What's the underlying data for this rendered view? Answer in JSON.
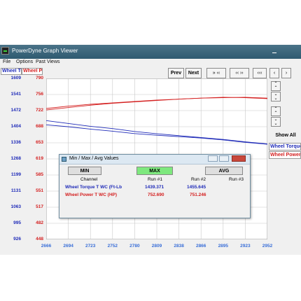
{
  "window": {
    "title": "PowerDyne Graph Viewer"
  },
  "menu": {
    "items": [
      "File",
      "Options",
      "Past Views"
    ]
  },
  "legend_header": {
    "torque_label": "Wheel Tc",
    "power_label": "Wheel Pc"
  },
  "toolbar": {
    "prev": "Prev",
    "next": "Next",
    "zoom_out_far": "» ‹‹",
    "zoom_in": "‹‹ ››",
    "scroll_left_far": "‹‹‹",
    "scroll_left": "‹",
    "scroll_right": "›"
  },
  "axes": {
    "torque_ticks": [
      "1609",
      "1541",
      "1472",
      "1404",
      "1336",
      "1268",
      "1199",
      "1131",
      "1063",
      "995",
      "926"
    ],
    "power_ticks": [
      "790",
      "756",
      "722",
      "688",
      "653",
      "619",
      "585",
      "551",
      "517",
      "482",
      "448"
    ],
    "x_ticks": [
      "2666",
      "2694",
      "2723",
      "2752",
      "2780",
      "2809",
      "2838",
      "2866",
      "2895",
      "2923",
      "2952"
    ]
  },
  "colors": {
    "torque": "#1f2bb8",
    "power": "#d42020",
    "x_tick": "#3a6fd8",
    "max_button": "#7ee87e"
  },
  "side_panel": {
    "show_all": "Show All",
    "legend": [
      {
        "label": "Wheel Torque",
        "series": "torque"
      },
      {
        "label": "Wheel Power T",
        "series": "power"
      }
    ]
  },
  "dialog": {
    "title": "Min / Max / Avg Values",
    "min_label": "MIN",
    "max_label": "MAX",
    "avg_label": "AVG",
    "headers": {
      "channel": "Channel",
      "run1": "Run #1",
      "run2": "Run #2",
      "run3": "Run #3"
    },
    "rows": [
      {
        "channel": "Wheel Torque T WC (Ft-Lb",
        "run1": "1439.371",
        "run2": "1455.645",
        "run3": "",
        "series": "torque"
      },
      {
        "channel": "Wheel Power T WC (HP)",
        "run1": "752.690",
        "run2": "751.246",
        "run3": "",
        "series": "power"
      }
    ]
  },
  "chart_data": {
    "type": "line",
    "x_range": [
      2666,
      2952
    ],
    "y_range_torque": [
      926,
      1609
    ],
    "y_range_power": [
      448,
      790
    ],
    "grid": true,
    "series": [
      {
        "name": "Wheel Torque T WC (Ft-Lb",
        "axis": "torque",
        "run": 1,
        "x": [
          2666,
          2694,
          2723,
          2752,
          2780,
          2809,
          2838,
          2866,
          2895,
          2923,
          2952
        ],
        "y": [
          1412,
          1404,
          1394,
          1385,
          1375,
          1368,
          1362,
          1356,
          1348,
          1338,
          1330
        ]
      },
      {
        "name": "Wheel Torque T WC (Ft-Lb",
        "axis": "torque",
        "run": 2,
        "x": [
          2666,
          2694,
          2723,
          2752,
          2780,
          2809,
          2838,
          2866,
          2895,
          2923,
          2952
        ],
        "y": [
          1430,
          1418,
          1406,
          1396,
          1384,
          1374,
          1366,
          1358,
          1350,
          1340,
          1331
        ]
      },
      {
        "name": "Wheel Power T WC (HP)",
        "axis": "power",
        "run": 1,
        "x": [
          2666,
          2694,
          2723,
          2752,
          2780,
          2809,
          2838,
          2866,
          2895,
          2923,
          2952
        ],
        "y": [
          726,
          731,
          735,
          738,
          741,
          744,
          746,
          748,
          749,
          750,
          748
        ]
      },
      {
        "name": "Wheel Power T WC (HP)",
        "axis": "power",
        "run": 2,
        "x": [
          2666,
          2694,
          2723,
          2752,
          2780,
          2809,
          2838,
          2866,
          2895,
          2923,
          2952
        ],
        "y": [
          723,
          728,
          733,
          737,
          740,
          743,
          746,
          748,
          750,
          749,
          747
        ]
      }
    ]
  }
}
